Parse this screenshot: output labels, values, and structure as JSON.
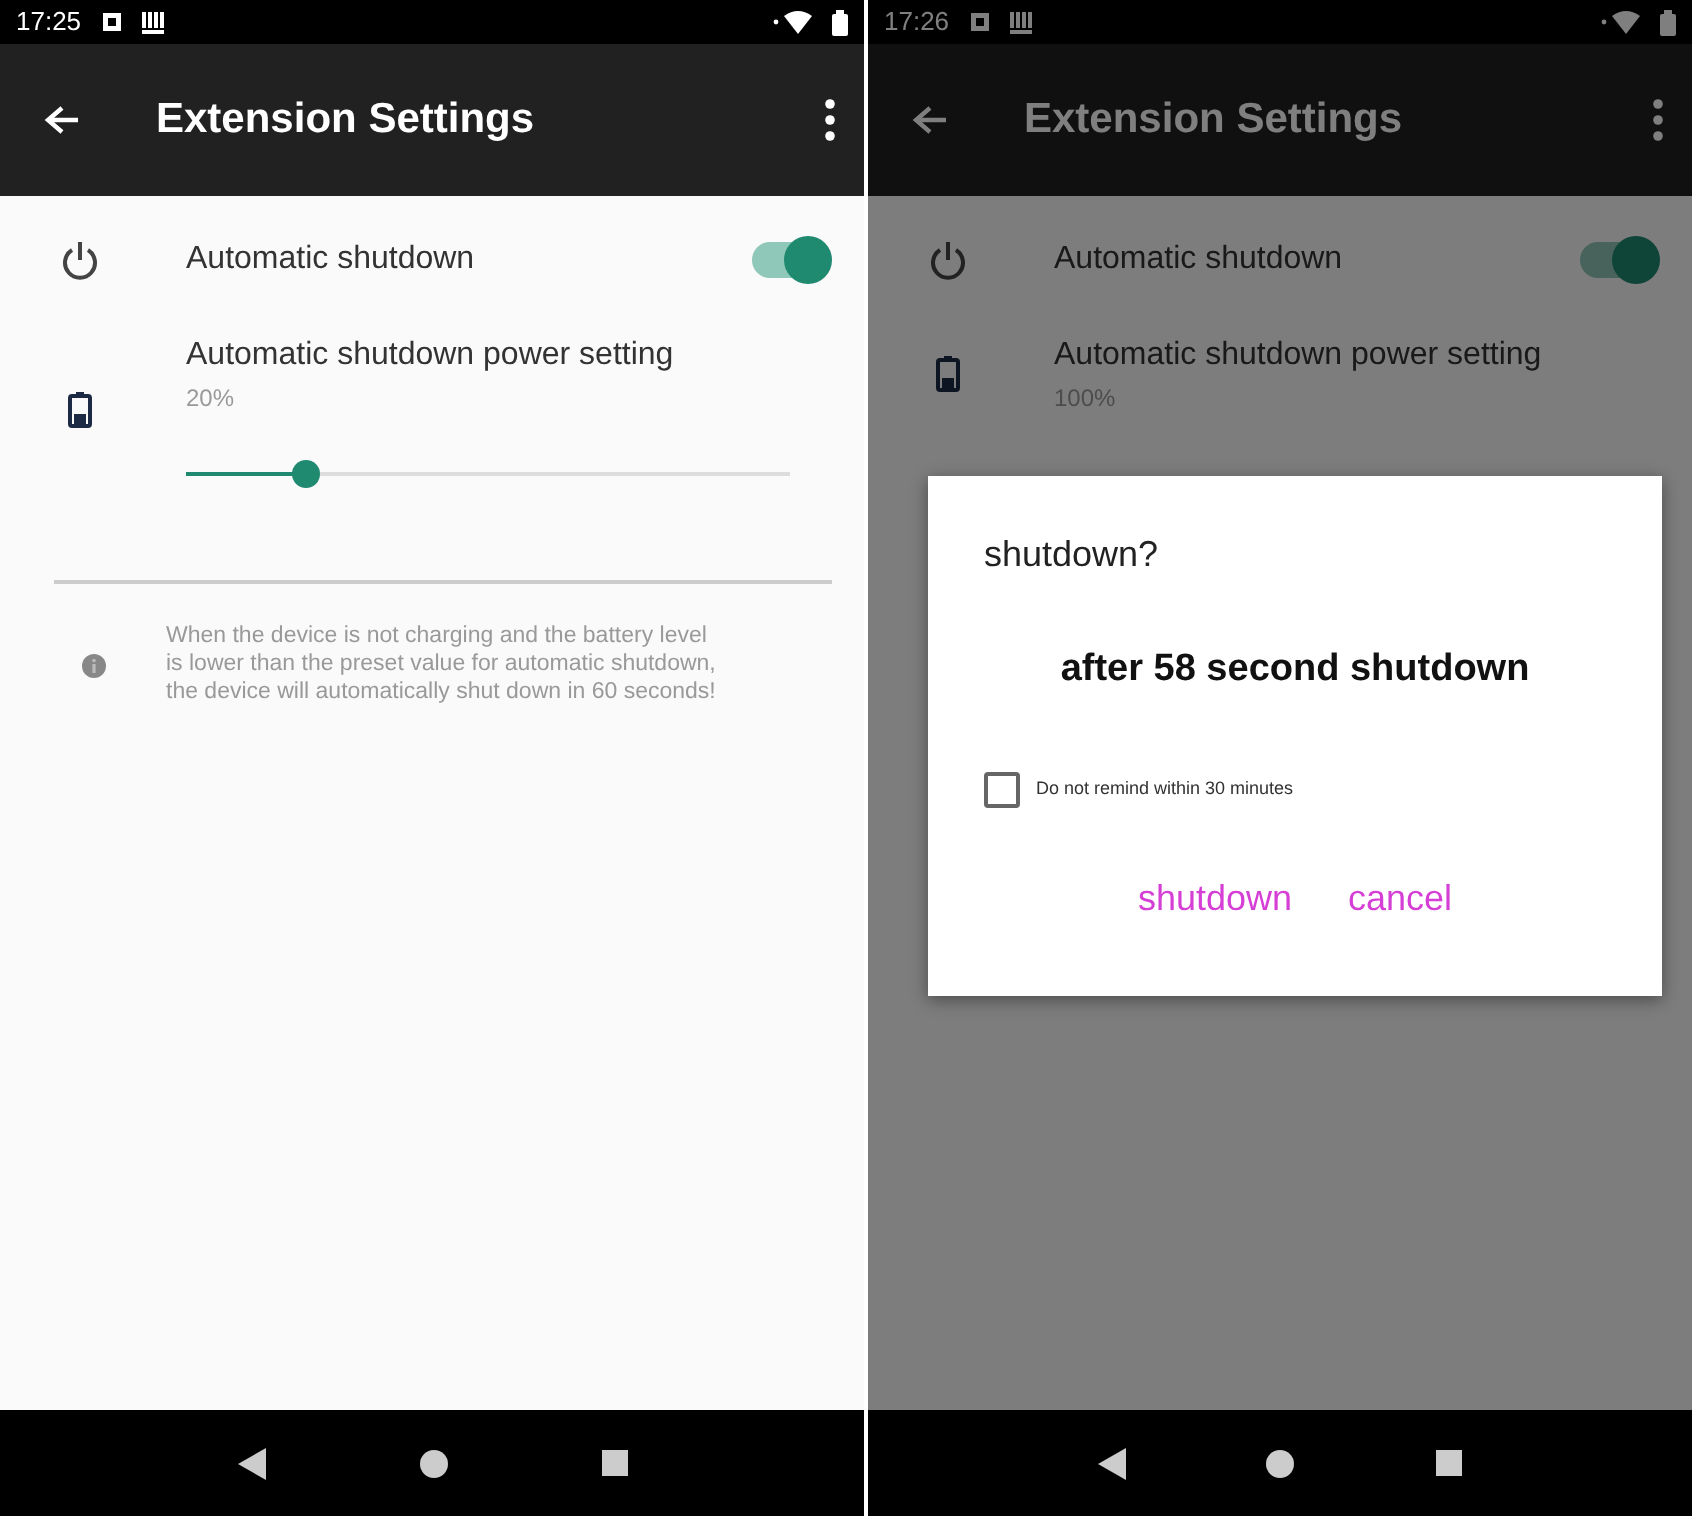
{
  "screens": [
    {
      "status_bar": {
        "time": "17:25"
      },
      "app_bar": {
        "title": "Extension Settings"
      },
      "dimmed": false,
      "settings": [
        {
          "kind": "switch",
          "title": "Automatic shutdown",
          "on": true
        },
        {
          "kind": "slider",
          "title": "Automatic shutdown power setting",
          "value": "20%",
          "level": 0.2
        }
      ],
      "note": "When the device is not charging and the battery level is lower than the preset value for automatic shutdown, the device will automatically shut down in 60 seconds!"
    },
    {
      "status_bar": {
        "time": "17:26"
      },
      "app_bar": {
        "title": "Extension Settings"
      },
      "dimmed": true,
      "settings": [
        {
          "kind": "switch",
          "title": "Automatic shutdown",
          "on": true
        },
        {
          "kind": "value",
          "title": "Automatic shutdown power setting",
          "value": "100%"
        }
      ],
      "dialog": {
        "title": "shutdown?",
        "message": "after 58 second shutdown",
        "checkbox": {
          "label": "Do not remind within 30 minutes",
          "checked": false
        },
        "buttons": [
          "shutdown",
          "cancel"
        ]
      }
    }
  ]
}
